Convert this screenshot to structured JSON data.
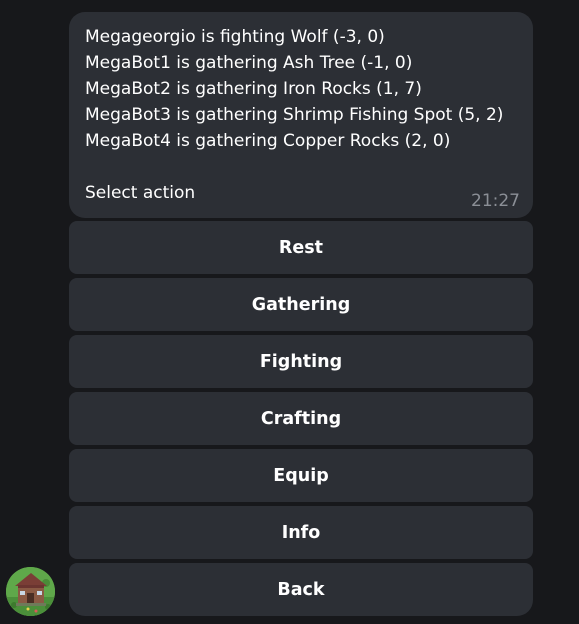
{
  "message": {
    "lines": [
      "Megageorgio is fighting Wolf (-3, 0)",
      "MegaBot1 is gathering Ash Tree (-1, 0)",
      "MegaBot2 is gathering Iron Rocks (1, 7)",
      "MegaBot3 is gathering Shrimp Fishing Spot (5, 2)",
      "MegaBot4 is gathering Copper Rocks (2, 0)"
    ],
    "prompt": "Select action",
    "time": "21:27"
  },
  "keyboard": {
    "buttons": [
      "Rest",
      "Gathering",
      "Fighting",
      "Crafting",
      "Equip",
      "Info",
      "Back"
    ]
  },
  "colors": {
    "background": "#17181b",
    "bubble": "#2c2f35",
    "timestamp": "#8b8f96"
  },
  "icons": {
    "avatar": "bot-avatar-house-icon"
  }
}
